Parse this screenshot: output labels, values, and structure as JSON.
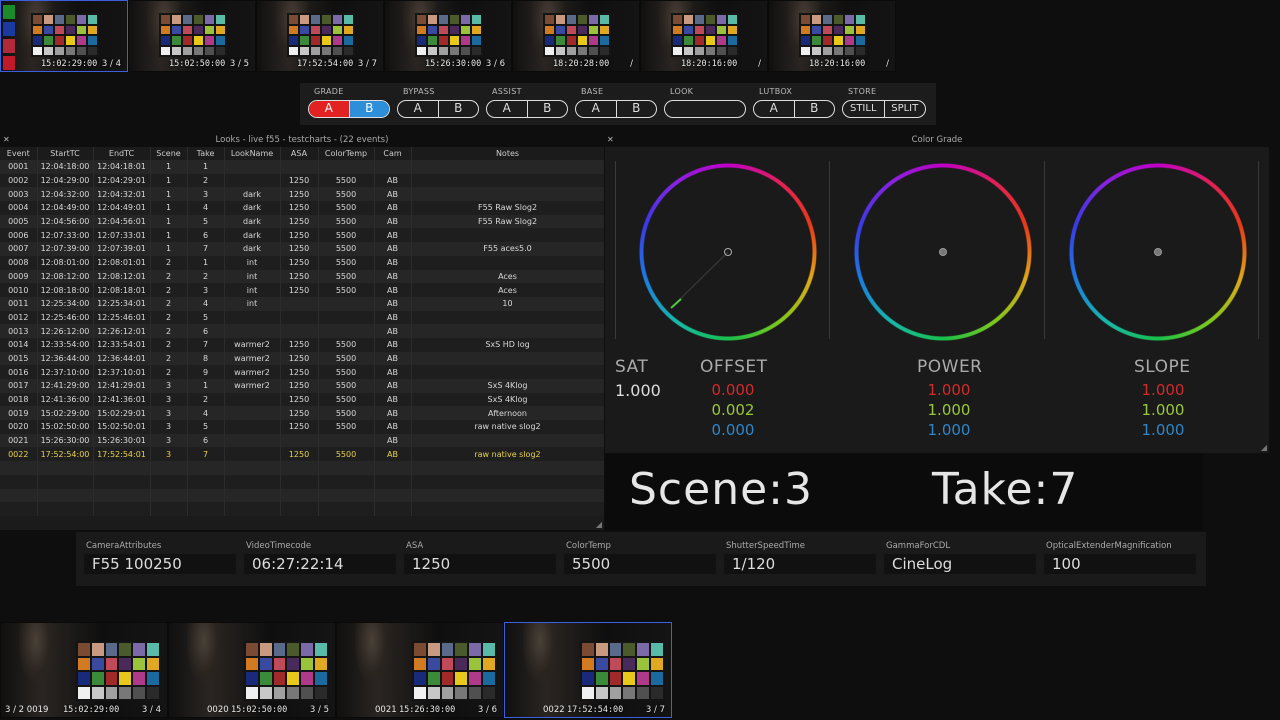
{
  "top_strip": [
    {
      "timecode": "15:02:29:00",
      "count": "3 / 4",
      "selected": true
    },
    {
      "timecode": "15:02:50:00",
      "count": "3 / 5",
      "selected": false
    },
    {
      "timecode": "17:52:54:00",
      "count": "3 / 7",
      "selected": false
    },
    {
      "timecode": "15:26:30:00",
      "count": "3 / 6",
      "selected": false
    },
    {
      "timecode": "18:20:28:00",
      "count": "/",
      "selected": false
    },
    {
      "timecode": "18:20:16:00",
      "count": "/",
      "selected": false
    },
    {
      "timecode": "18:20:16:00",
      "count": "/",
      "selected": false
    }
  ],
  "toolbar": {
    "grade": {
      "label": "GRADE",
      "a": "A",
      "b": "B"
    },
    "bypass": {
      "label": "BYPASS",
      "a": "A",
      "b": "B"
    },
    "assist": {
      "label": "ASSIST",
      "a": "A",
      "b": "B"
    },
    "base": {
      "label": "BASE",
      "a": "A",
      "b": "B"
    },
    "look": {
      "label": "LOOK"
    },
    "lutbox": {
      "label": "LUTBOX",
      "a": "A",
      "b": "B"
    },
    "store": {
      "label": "STORE",
      "still": "STILL",
      "split": "SPLIT"
    }
  },
  "looks": {
    "title": "Looks - live f55 - testcharts - (22 events)",
    "columns": [
      "Event",
      "StartTC",
      "EndTC",
      "Scene",
      "Take",
      "LookName",
      "ASA",
      "ColorTemp",
      "Cam",
      "Notes"
    ],
    "rows": [
      [
        "0001",
        "12:04:18:00",
        "12:04:18:01",
        "1",
        "1",
        "",
        "",
        "",
        "",
        ""
      ],
      [
        "0002",
        "12:04:29:00",
        "12:04:29:01",
        "1",
        "2",
        "",
        "1250",
        "5500",
        "AB",
        ""
      ],
      [
        "0003",
        "12:04:32:00",
        "12:04:32:01",
        "1",
        "3",
        "dark",
        "1250",
        "5500",
        "AB",
        ""
      ],
      [
        "0004",
        "12:04:49:00",
        "12:04:49:01",
        "1",
        "4",
        "dark",
        "1250",
        "5500",
        "AB",
        "F55 Raw Slog2"
      ],
      [
        "0005",
        "12:04:56:00",
        "12:04:56:01",
        "1",
        "5",
        "dark",
        "1250",
        "5500",
        "AB",
        "F55 Raw Slog2"
      ],
      [
        "0006",
        "12:07:33:00",
        "12:07:33:01",
        "1",
        "6",
        "dark",
        "1250",
        "5500",
        "AB",
        ""
      ],
      [
        "0007",
        "12:07:39:00",
        "12:07:39:01",
        "1",
        "7",
        "dark",
        "1250",
        "5500",
        "AB",
        "F55 aces5.0"
      ],
      [
        "0008",
        "12:08:01:00",
        "12:08:01:01",
        "2",
        "1",
        "int",
        "1250",
        "5500",
        "AB",
        ""
      ],
      [
        "0009",
        "12:08:12:00",
        "12:08:12:01",
        "2",
        "2",
        "int",
        "1250",
        "5500",
        "AB",
        "Aces"
      ],
      [
        "0010",
        "12:08:18:00",
        "12:08:18:01",
        "2",
        "3",
        "int",
        "1250",
        "5500",
        "AB",
        "Aces"
      ],
      [
        "0011",
        "12:25:34:00",
        "12:25:34:01",
        "2",
        "4",
        "int",
        "",
        "",
        "AB",
        "10"
      ],
      [
        "0012",
        "12:25:46:00",
        "12:25:46:01",
        "2",
        "5",
        "",
        "",
        "",
        "AB",
        ""
      ],
      [
        "0013",
        "12:26:12:00",
        "12:26:12:01",
        "2",
        "6",
        "",
        "",
        "",
        "AB",
        ""
      ],
      [
        "0014",
        "12:33:54:00",
        "12:33:54:01",
        "2",
        "7",
        "warmer2",
        "1250",
        "5500",
        "AB",
        "SxS HD log"
      ],
      [
        "0015",
        "12:36:44:00",
        "12:36:44:01",
        "2",
        "8",
        "warmer2",
        "1250",
        "5500",
        "AB",
        ""
      ],
      [
        "0016",
        "12:37:10:00",
        "12:37:10:01",
        "2",
        "9",
        "warmer2",
        "1250",
        "5500",
        "AB",
        ""
      ],
      [
        "0017",
        "12:41:29:00",
        "12:41:29:01",
        "3",
        "1",
        "warmer2",
        "1250",
        "5500",
        "AB",
        "SxS 4Klog"
      ],
      [
        "0018",
        "12:41:36:00",
        "12:41:36:01",
        "3",
        "2",
        "",
        "1250",
        "5500",
        "AB",
        "SxS 4Klog"
      ],
      [
        "0019",
        "15:02:29:00",
        "15:02:29:01",
        "3",
        "4",
        "",
        "1250",
        "5500",
        "AB",
        "Afternoon"
      ],
      [
        "0020",
        "15:02:50:00",
        "15:02:50:01",
        "3",
        "5",
        "",
        "1250",
        "5500",
        "AB",
        "raw native slog2"
      ],
      [
        "0021",
        "15:26:30:00",
        "15:26:30:01",
        "3",
        "6",
        "",
        "",
        "",
        "AB",
        ""
      ],
      [
        "0022",
        "17:52:54:00",
        "17:52:54:01",
        "3",
        "7",
        "",
        "1250",
        "5500",
        "AB",
        "raw native slog2"
      ]
    ]
  },
  "color_grade": {
    "title": "Color Grade",
    "sat_label": "SAT",
    "sat_value": "1.000",
    "offset": {
      "label": "OFFSET",
      "r": "0.000",
      "g": "0.002",
      "b": "0.000"
    },
    "power": {
      "label": "POWER",
      "r": "1.000",
      "g": "1.000",
      "b": "1.000"
    },
    "slope": {
      "label": "SLOPE",
      "r": "1.000",
      "g": "1.000",
      "b": "1.000"
    }
  },
  "scene_take": {
    "scene_label": "Scene:",
    "scene": "3",
    "take_label": "Take:",
    "take": "7"
  },
  "attributes": [
    {
      "key": "CameraAttributes",
      "value": "F55 100250"
    },
    {
      "key": "VideoTimecode",
      "value": "06:27:22:14"
    },
    {
      "key": "ASA",
      "value": "1250"
    },
    {
      "key": "ColorTemp",
      "value": "5500"
    },
    {
      "key": "ShutterSpeedTime",
      "value": "1/120"
    },
    {
      "key": "GammaForCDL",
      "value": "CineLog"
    },
    {
      "key": "OpticalExtenderMagnification",
      "value": "100"
    }
  ],
  "bottom_strip": [
    {
      "label": "3 / 2   0019",
      "timecode": "15:02:29:00",
      "count": "3 / 4",
      "selected": false
    },
    {
      "label": "0020",
      "timecode": "15:02:50:00",
      "count": "3 / 5",
      "selected": false
    },
    {
      "label": "0021",
      "timecode": "15:26:30:00",
      "count": "3 / 6",
      "selected": false
    },
    {
      "label": "0022",
      "timecode": "17:52:54:00",
      "count": "3 / 7",
      "selected": true
    }
  ],
  "colors": {
    "accent_red": "#e22222",
    "accent_blue": "#2d8fd9",
    "selection": "#3b5fe0",
    "highlight_row": "#e8d24a"
  },
  "icons": {
    "panel_close": "close-icon",
    "wheel_center": "crosshair-icon"
  }
}
